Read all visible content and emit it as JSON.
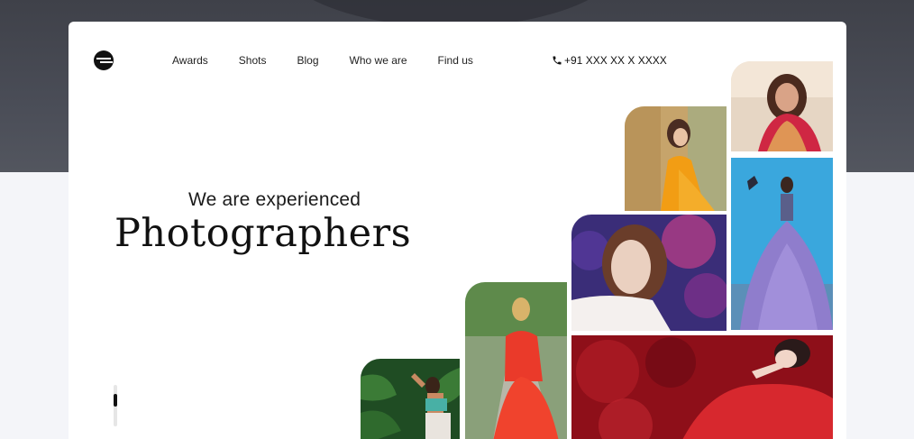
{
  "nav": {
    "items": [
      {
        "label": "Awards"
      },
      {
        "label": "Shots"
      },
      {
        "label": "Blog"
      },
      {
        "label": "Who we are"
      },
      {
        "label": "Find us"
      }
    ]
  },
  "contact": {
    "phone": "+91 XXX XX X XXXX",
    "icon": "phone-icon"
  },
  "hero": {
    "subtitle": "We are experienced",
    "title": "Photographers"
  },
  "gallery": {
    "photos": [
      {
        "name": "photo-woman-orange-dress-field",
        "palette": [
          "#c7a46a",
          "#f0a21c",
          "#5a3a2a"
        ]
      },
      {
        "name": "photo-bride-red-saree",
        "palette": [
          "#e7d9c9",
          "#d22d47",
          "#6b2b1f"
        ]
      },
      {
        "name": "photo-woman-purple-gown",
        "palette": [
          "#3aa3d8",
          "#8b78c9",
          "#2a3d5e"
        ]
      },
      {
        "name": "photo-woman-portrait-purple-flowers",
        "palette": [
          "#3b2c7a",
          "#c73b74",
          "#e8d6cc"
        ]
      },
      {
        "name": "photo-woman-red-dress-walkway",
        "palette": [
          "#5f8a4c",
          "#ea3b2a",
          "#a9a89a"
        ]
      },
      {
        "name": "photo-woman-red-dress-lying",
        "palette": [
          "#8e0f19",
          "#d52a2f",
          "#f2d9cc"
        ]
      },
      {
        "name": "photo-woman-ferns",
        "palette": [
          "#1e4d22",
          "#3c7c38",
          "#c88a63"
        ]
      }
    ]
  },
  "colors": {
    "backdrop": "#474a53",
    "card": "#ffffff",
    "text": "#111111"
  }
}
